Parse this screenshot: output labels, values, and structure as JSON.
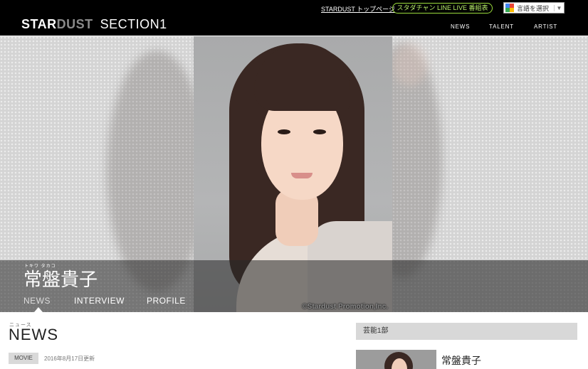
{
  "header": {
    "logo": {
      "star": "STAR",
      "dust": "DUST",
      "section": "SECTION1"
    },
    "top_link": "STARDUST トップページ",
    "line_live": "スタダチャン LINE LIVE 番組表",
    "translate_label": "言語を選択",
    "translate_chevron": "▼",
    "nav": [
      "NEWS",
      "TALENT",
      "ARTIST"
    ]
  },
  "hero": {
    "ruby": "トキワ タカコ",
    "name": "常盤貴子",
    "tabs": [
      "NEWS",
      "INTERVIEW",
      "PROFILE"
    ],
    "active_tab": "NEWS",
    "copyright": "©Stardust Promotion,Inc."
  },
  "news": {
    "ruby": "ニュース",
    "title": "NEWS",
    "first_item": {
      "tag": "MOVIE",
      "date": "2016年8月17日更新"
    }
  },
  "sidebar": {
    "department": "芸能1部",
    "talent_name": "常盤貴子"
  },
  "colors": {
    "header_bg": "#000000",
    "line_live_accent": "#9bdc3c"
  }
}
